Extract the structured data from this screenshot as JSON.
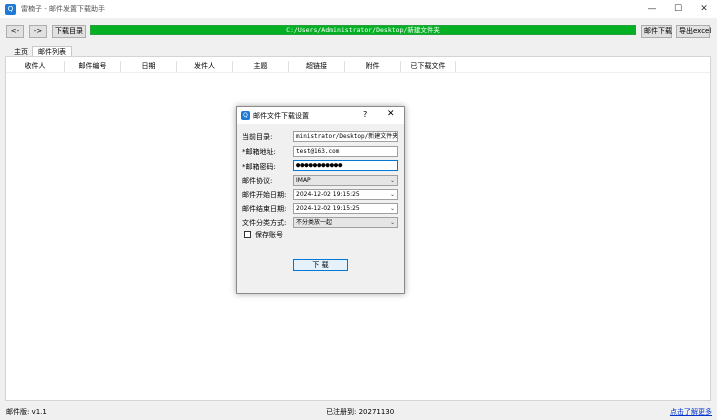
{
  "window": {
    "title": "雷楠子 - 邮件发置下载助手",
    "controls": [
      "—",
      "☐",
      "✕"
    ]
  },
  "toolbar": {
    "back_label": "<-",
    "forward_label": "->",
    "download_dir_label": "下载目录",
    "path_value": "C:/Users/Administrator/Desktop/新建文件夹",
    "path_bar_color": "#06b025",
    "mail_download_label": "邮件下载",
    "export_excel_label": "导出excel"
  },
  "tabs": [
    {
      "label": "主页",
      "active": false
    },
    {
      "label": "邮件列表",
      "active": true
    }
  ],
  "table": {
    "columns": [
      "收件人",
      "邮件编号",
      "日期",
      "发件人",
      "主题",
      "超链接",
      "附件",
      "已下载文件"
    ],
    "rows": []
  },
  "status": {
    "version": "邮件版: v1.1",
    "registered": "已注册到: 20271130",
    "more_link": "点击了解更多"
  },
  "dialog": {
    "title": "邮件文件下载设置",
    "help": "?",
    "close": "✕",
    "fields": {
      "current_dir_label": "当前目录:",
      "current_dir_value": "ministrator/Desktop/新建文件夹",
      "email_label": "*邮箱地址:",
      "email_value": "test@163.com",
      "password_label": "*邮箱密码:",
      "password_value": "●●●●●●●●●●●",
      "protocol_label": "邮件协议:",
      "protocol_value": "IMAP",
      "start_date_label": "邮件开始日期:",
      "start_date_value": "2024-12-02 19:15:25",
      "end_date_label": "邮件结束日期:",
      "end_date_value": "2024-12-02 19:15:25",
      "classify_label": "文件分类方式:",
      "classify_value": "不分类放一起"
    },
    "save_account_label": "保存账号",
    "save_account_checked": false,
    "download_label": "下 载"
  }
}
